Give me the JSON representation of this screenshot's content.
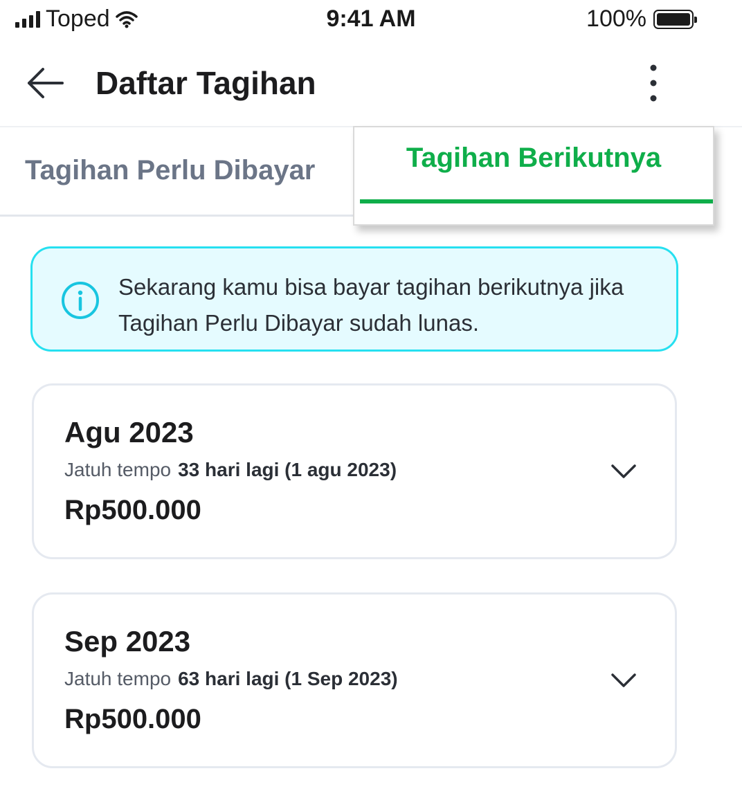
{
  "status_bar": {
    "carrier": "Toped",
    "time": "9:41 AM",
    "battery": "100%",
    "icons": [
      "signal-icon",
      "wifi-icon",
      "battery-icon"
    ]
  },
  "header": {
    "title": "Daftar Tagihan",
    "back_icon": "arrow-left-icon",
    "menu_icon": "more-vertical-icon"
  },
  "tabs": [
    {
      "label": "Tagihan Perlu Dibayar",
      "active": false
    },
    {
      "label": "Tagihan Berikutnya",
      "active": true
    }
  ],
  "info_banner": {
    "icon": "info-icon",
    "text": "Sekarang kamu bisa bayar tagihan berikutnya jika Tagihan Perlu Dibayar sudah lunas."
  },
  "bills": [
    {
      "month": "Agu 2023",
      "due_label": "Jatuh tempo",
      "due_value": "33 hari lagi (1 agu 2023)",
      "amount": "Rp500.000",
      "expand_icon": "chevron-down-icon"
    },
    {
      "month": "Sep 2023",
      "due_label": "Jatuh tempo",
      "due_value": "63 hari lagi (1 Sep 2023)",
      "amount": "Rp500.000",
      "expand_icon": "chevron-down-icon"
    }
  ],
  "colors": {
    "accent": "#0FAE4A",
    "info_border": "#26E0F0",
    "info_background": "#E5FBFF",
    "inactive_tab": "#6B7587"
  }
}
